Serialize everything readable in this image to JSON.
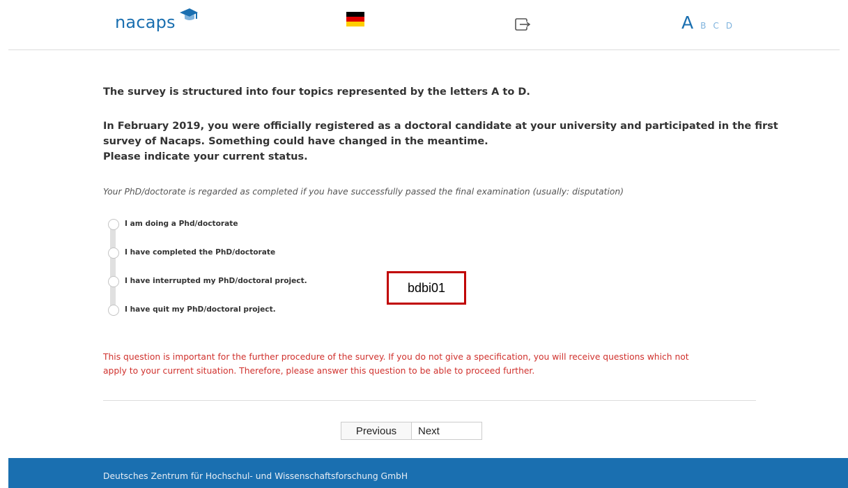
{
  "header": {
    "logo_text": "nacaps",
    "steps": {
      "active": "A",
      "others": [
        "B",
        "C",
        "D"
      ]
    },
    "icons": {
      "language_flag": "german-flag-icon",
      "exit": "exit-icon",
      "logo_cap": "graduation-cap-icon"
    },
    "colors": {
      "brand_blue": "#1a6fb0",
      "step_inactive": "#7fb3dd"
    }
  },
  "content": {
    "intro": "The survey is structured into four topics represented by the letters A to D.",
    "question_lines": [
      "In February 2019, you were officially registered as a doctoral candidate at your university and participated in the first",
      "survey of Nacaps. Something could have changed in the meantime.",
      "Please indicate your current status."
    ],
    "hint": "Your PhD/doctorate is regarded as completed if you have successfully passed the final examination (usually: disputation)",
    "options": [
      "I am doing a Phd/doctorate",
      "I have completed the PhD/doctorate",
      "I have interrupted my PhD/doctoral project.",
      "I have quit my PhD/doctoral project."
    ],
    "variable_code": "bdbi01",
    "warning_lines": [
      "This question is important for the further procedure of the survey. If you do not give a specification, you will receive questions which not",
      "apply to your current situation. Therefore, please answer this question to be able to proceed further."
    ],
    "colors": {
      "warning": "#d0312d",
      "code_box_border": "#c00000"
    }
  },
  "navigation": {
    "previous": "Previous",
    "next": "Next"
  },
  "footer": {
    "text": "Deutsches Zentrum für Hochschul- und Wissenschaftsforschung GmbH",
    "color": "#1a6fb0"
  }
}
